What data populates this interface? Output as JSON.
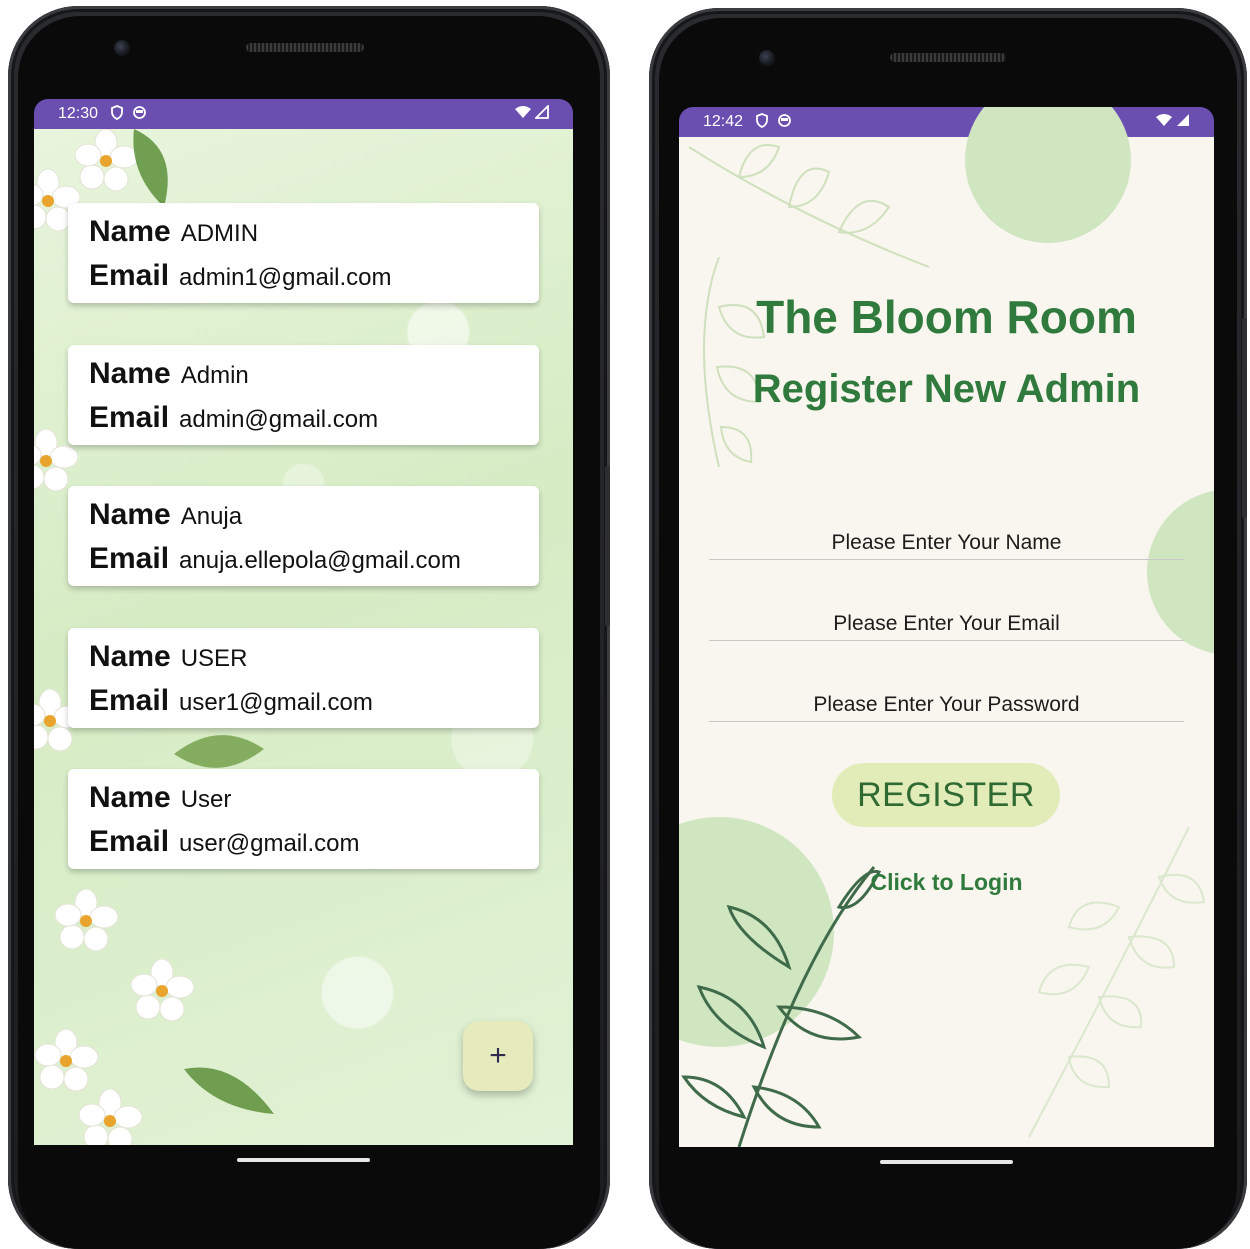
{
  "colors": {
    "status_bar": "#6a4fb0",
    "title_green": "#2f7a3c",
    "register_button": "#e2ecb9",
    "fab": "#e5ebbd"
  },
  "left_screen": {
    "status_bar": {
      "time": "12:30",
      "icons": [
        "shield-icon",
        "record-icon",
        "wifi-icon",
        "signal-icon"
      ]
    },
    "cards": [
      {
        "name_label": "Name",
        "name": "ADMIN",
        "email_label": "Email",
        "email": "admin1@gmail.com"
      },
      {
        "name_label": "Name",
        "name": "Admin",
        "email_label": "Email",
        "email": "admin@gmail.com"
      },
      {
        "name_label": "Name",
        "name": "Anuja",
        "email_label": "Email",
        "email": "anuja.ellepola@gmail.com"
      },
      {
        "name_label": "Name",
        "name": "USER",
        "email_label": "Email",
        "email": "user1@gmail.com"
      },
      {
        "name_label": "Name",
        "name": "User",
        "email_label": "Email",
        "email": "user@gmail.com"
      }
    ],
    "fab_label": "+"
  },
  "right_screen": {
    "status_bar": {
      "time": "12:42",
      "icons": [
        "shield-icon",
        "record-icon",
        "wifi-icon",
        "signal-icon"
      ]
    },
    "app_title": "The Bloom Room",
    "subtitle": "Register New Admin",
    "fields": {
      "name_placeholder": "Please Enter Your Name",
      "email_placeholder": "Please Enter Your Email",
      "password_placeholder": "Please Enter Your Password"
    },
    "register_label": "REGISTER",
    "login_link": "Click to Login"
  }
}
